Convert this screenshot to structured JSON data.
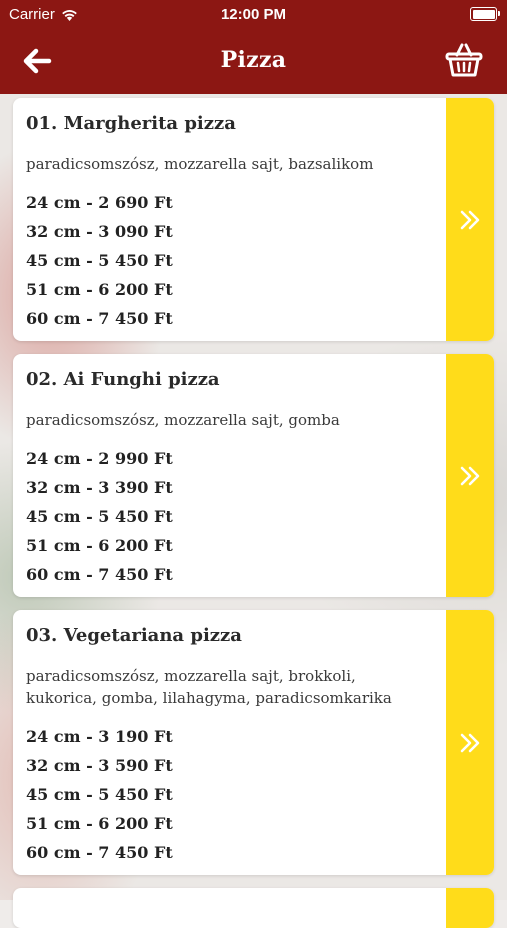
{
  "status_bar": {
    "carrier": "Carrier",
    "time": "12:00 PM"
  },
  "header": {
    "title": "Pizza",
    "back_icon": "back-arrow-icon",
    "cart_icon": "basket-icon"
  },
  "colors": {
    "header": "#8c1713",
    "accent": "#ffdc1a"
  },
  "items": [
    {
      "name": "01. Margherita pizza",
      "description": "paradicsomszósz, mozzarella sajt, bazsalikom",
      "prices": [
        "24 cm - 2 690 Ft",
        "32 cm - 3 090 Ft",
        "45 cm - 5 450 Ft",
        "51 cm - 6 200 Ft",
        "60 cm - 7 450 Ft"
      ]
    },
    {
      "name": "02. Ai Funghi pizza",
      "description": "paradicsomszósz, mozzarella sajt, gomba",
      "prices": [
        "24 cm - 2 990 Ft",
        "32 cm - 3 390 Ft",
        "45 cm - 5 450 Ft",
        "51 cm - 6 200 Ft",
        "60 cm - 7 450 Ft"
      ]
    },
    {
      "name": "03. Vegetariana pizza",
      "description": "paradicsomszósz, mozzarella sajt, brokkoli, kukorica, gomba, lilahagyma, paradicsomkarika",
      "prices": [
        "24 cm - 3 190 Ft",
        "32 cm - 3 590 Ft",
        "45 cm - 5 450 Ft",
        "51 cm - 6 200 Ft",
        "60 cm - 7 450 Ft"
      ]
    }
  ]
}
